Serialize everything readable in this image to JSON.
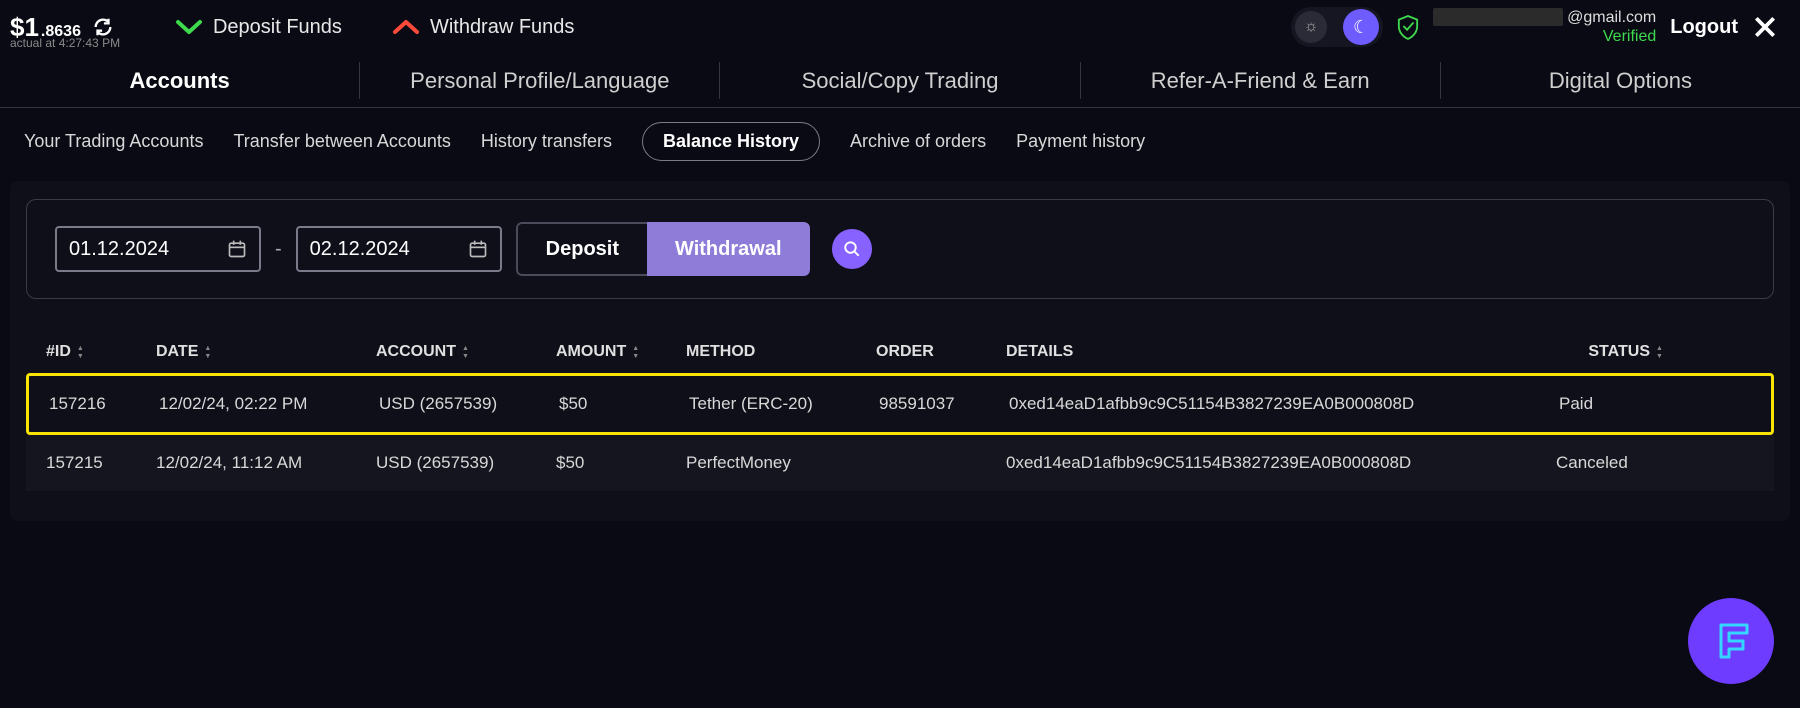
{
  "header": {
    "balance_major": "$1",
    "balance_minor": ".8636",
    "actual_at_label": "actual at 4:27:43 PM",
    "deposit_label": "Deposit Funds",
    "withdraw_label": "Withdraw Funds",
    "email_domain": "@gmail.com",
    "verified_label": "Verified",
    "logout_label": "Logout"
  },
  "main_nav": {
    "accounts": "Accounts",
    "profile": "Personal Profile/Language",
    "social": "Social/Copy Trading",
    "refer": "Refer-A-Friend & Earn",
    "digital": "Digital Options"
  },
  "sub_nav": {
    "trading_accounts": "Your Trading Accounts",
    "transfer": "Transfer between Accounts",
    "history_transfers": "History transfers",
    "balance_history": "Balance History",
    "archive": "Archive of orders",
    "payments": "Payment history"
  },
  "filters": {
    "date_from": "01.12.2024",
    "date_to": "02.12.2024",
    "seg_deposit": "Deposit",
    "seg_withdrawal": "Withdrawal"
  },
  "table": {
    "headers": {
      "id": "#ID",
      "date": "DATE",
      "account": "ACCOUNT",
      "amount": "AMOUNT",
      "method": "METHOD",
      "order": "ORDER",
      "details": "DETAILS",
      "status": "STATUS"
    },
    "rows": [
      {
        "id": "157216",
        "date": "12/02/24, 02:22 PM",
        "account": "USD (2657539)",
        "amount": "$50",
        "method": "Tether (ERC-20)",
        "order": "98591037",
        "details": "0xed14eaD1afbb9c9C51154B3827239EA0B000808D",
        "status": "Paid"
      },
      {
        "id": "157215",
        "date": "12/02/24, 11:12 AM",
        "account": "USD (2657539)",
        "amount": "$50",
        "method": "PerfectMoney",
        "order": "",
        "details": "0xed14eaD1afbb9c9C51154B3827239EA0B000808D",
        "status": "Canceled"
      }
    ]
  }
}
